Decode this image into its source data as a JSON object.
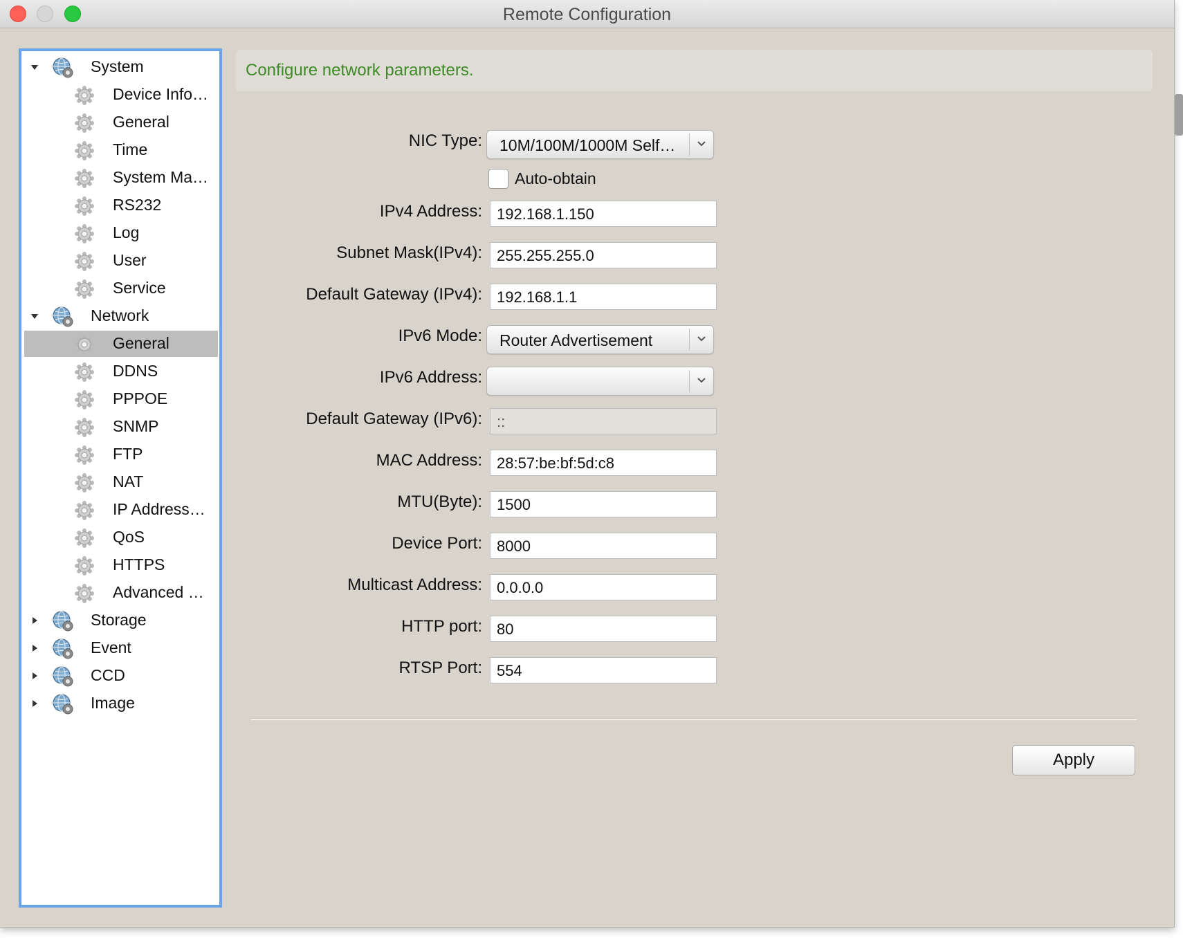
{
  "window": {
    "title": "Remote Configuration"
  },
  "tree": {
    "items": [
      {
        "label": "System",
        "level": 0,
        "expanded": true
      },
      {
        "label": "Device Info…",
        "level": 1
      },
      {
        "label": "General",
        "level": 1
      },
      {
        "label": "Time",
        "level": 1
      },
      {
        "label": "System Ma…",
        "level": 1
      },
      {
        "label": "RS232",
        "level": 1
      },
      {
        "label": "Log",
        "level": 1
      },
      {
        "label": "User",
        "level": 1
      },
      {
        "label": "Service",
        "level": 1
      },
      {
        "label": "Network",
        "level": 0,
        "expanded": true
      },
      {
        "label": "General",
        "level": 1,
        "selected": true
      },
      {
        "label": "DDNS",
        "level": 1
      },
      {
        "label": "PPPOE",
        "level": 1
      },
      {
        "label": "SNMP",
        "level": 1
      },
      {
        "label": "FTP",
        "level": 1
      },
      {
        "label": "NAT",
        "level": 1
      },
      {
        "label": "IP Address…",
        "level": 1
      },
      {
        "label": "QoS",
        "level": 1
      },
      {
        "label": "HTTPS",
        "level": 1
      },
      {
        "label": "Advanced …",
        "level": 1
      },
      {
        "label": "Storage",
        "level": 0,
        "expanded": false
      },
      {
        "label": "Event",
        "level": 0,
        "expanded": false
      },
      {
        "label": "CCD",
        "level": 0,
        "expanded": false
      },
      {
        "label": "Image",
        "level": 0,
        "expanded": false
      }
    ]
  },
  "banner": {
    "text": "Configure network parameters."
  },
  "form": {
    "nic_type": {
      "label": "NIC Type:",
      "value": "10M/100M/1000M Self…"
    },
    "auto_obtain": {
      "label": "Auto-obtain",
      "checked": false
    },
    "ipv4_address": {
      "label": "IPv4 Address:",
      "value": "192.168.1.150"
    },
    "subnet_mask": {
      "label": "Subnet Mask(IPv4):",
      "value": "255.255.255.0"
    },
    "gateway_ipv4": {
      "label": "Default Gateway (IPv4):",
      "value": "192.168.1.1"
    },
    "ipv6_mode": {
      "label": "IPv6 Mode:",
      "value": "Router Advertisement"
    },
    "ipv6_address": {
      "label": "IPv6 Address:",
      "value": ""
    },
    "gateway_ipv6": {
      "label": "Default Gateway (IPv6):",
      "value": "::"
    },
    "mac_address": {
      "label": "MAC Address:",
      "value": "28:57:be:bf:5d:c8"
    },
    "mtu": {
      "label": "MTU(Byte):",
      "value": "1500"
    },
    "device_port": {
      "label": "Device Port:",
      "value": "8000"
    },
    "multicast_address": {
      "label": "Multicast Address:",
      "value": "0.0.0.0"
    },
    "http_port": {
      "label": "HTTP port:",
      "value": "80"
    },
    "rtsp_port": {
      "label": "RTSP Port:",
      "value": "554"
    }
  },
  "actions": {
    "apply_label": "Apply"
  },
  "colors": {
    "banner_text": "#3d8a26",
    "tree_focus_border": "#6aa3e6",
    "selection": "#bdbdbd",
    "window_bg": "#d8d4cb"
  },
  "icons": {
    "group": "globe-gear-icon",
    "leaf": "gear-icon",
    "expanded": "disclosure-down-icon",
    "collapsed": "disclosure-right-icon"
  }
}
